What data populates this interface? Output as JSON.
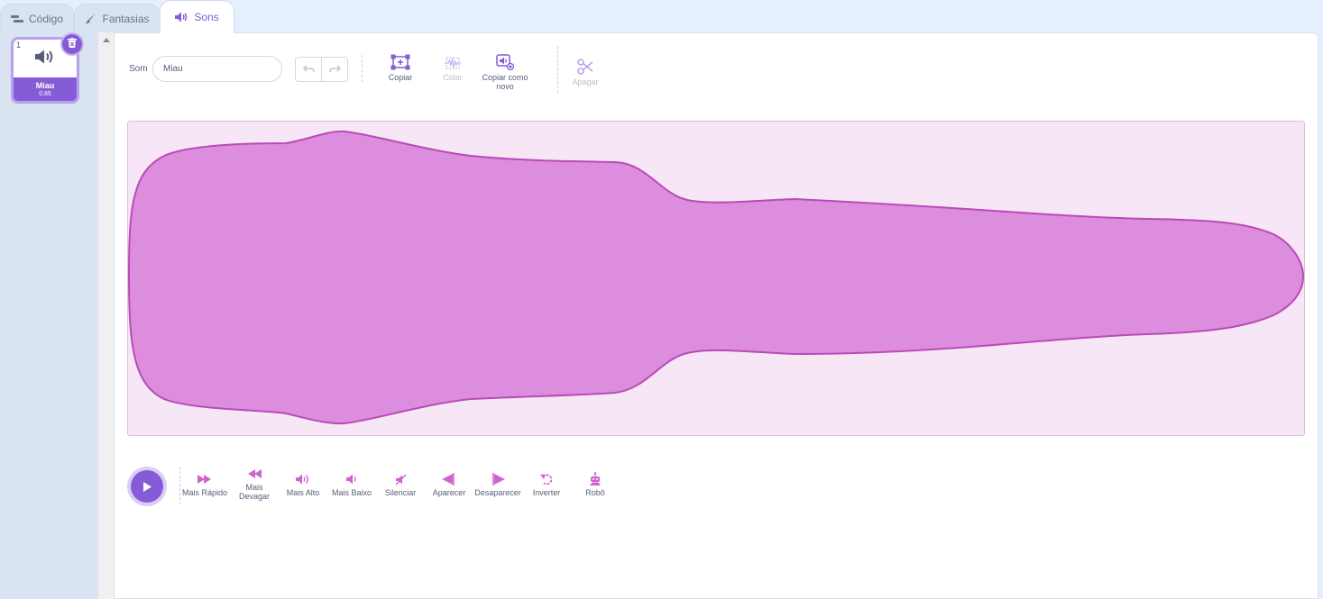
{
  "tabs": [
    {
      "label": "Código",
      "icon": "code-blocks-icon"
    },
    {
      "label": "Fantasias",
      "icon": "paintbrush-icon"
    },
    {
      "label": "Sons",
      "icon": "speaker-icon"
    }
  ],
  "sound_list": {
    "items": [
      {
        "index": "1",
        "name": "Miau",
        "duration": "0.85",
        "icon": "speaker-icon"
      }
    ]
  },
  "editor": {
    "sound_label": "Som",
    "sound_name_value": "Miau",
    "tools": {
      "copy": "Copiar",
      "paste": "Colar",
      "copy_new": "Copiar como novo",
      "delete": "Apagar"
    },
    "effects": [
      {
        "label": "Mais Rápido",
        "icon": "faster-icon"
      },
      {
        "label": "Mais Devagar",
        "icon": "slower-icon"
      },
      {
        "label": "Mais Alto",
        "icon": "louder-icon"
      },
      {
        "label": "Mais Baixo",
        "icon": "softer-icon"
      },
      {
        "label": "Silenciar",
        "icon": "mute-icon"
      },
      {
        "label": "Aparecer",
        "icon": "fade-in-icon"
      },
      {
        "label": "Desaparecer",
        "icon": "fade-out-icon"
      },
      {
        "label": "Inverter",
        "icon": "reverse-icon"
      },
      {
        "label": "Robô",
        "icon": "robot-icon"
      }
    ]
  },
  "colors": {
    "accent": "#855cd6",
    "wave_fill": "#dd8ddd",
    "wave_stroke": "#b84bb8",
    "wave_bg": "#f7e6f6",
    "effect_icon": "#cf63cf"
  }
}
